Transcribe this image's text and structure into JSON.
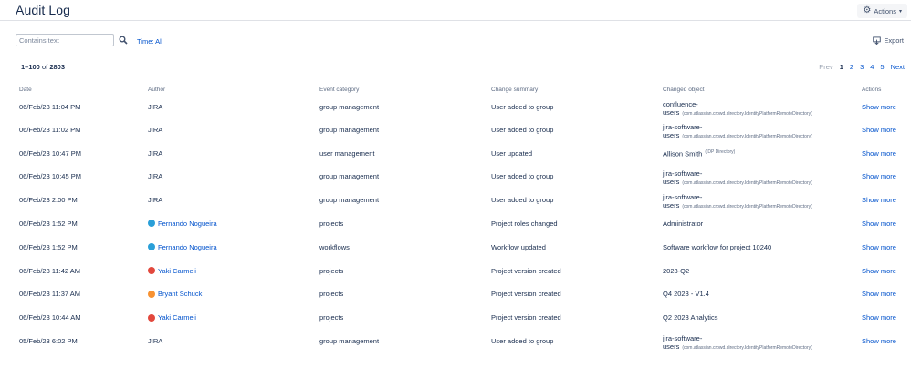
{
  "header": {
    "title": "Audit Log",
    "actions_label": "Actions"
  },
  "toolbar": {
    "search_placeholder": "Contains text",
    "time_filter": "Time: All",
    "export_label": "Export"
  },
  "summary": {
    "range": "1–100",
    "of": "of",
    "total": "2803"
  },
  "pagination": {
    "prev": "Prev",
    "pages": [
      "1",
      "2",
      "3",
      "4",
      "5"
    ],
    "current": "1",
    "next": "Next"
  },
  "columns": [
    "Date",
    "Author",
    "Event category",
    "Change summary",
    "Changed object",
    "Actions"
  ],
  "rows": [
    {
      "date": "06/Feb/23 11:04 PM",
      "author": "JIRA",
      "author_link": false,
      "avatar_color": "",
      "category": "group management",
      "summary": "User added to group",
      "object_line1": "confluence-",
      "object_line2": "users",
      "object_detail": "(com.atlassian.crowd.directory.IdentityPlatformRemoteDirectory)",
      "action": "Show more"
    },
    {
      "date": "06/Feb/23 11:02 PM",
      "author": "JIRA",
      "author_link": false,
      "avatar_color": "",
      "category": "group management",
      "summary": "User added to group",
      "object_line1": "jira-software-",
      "object_line2": "users",
      "object_detail": "(com.atlassian.crowd.directory.IdentityPlatformRemoteDirectory)",
      "action": "Show more"
    },
    {
      "date": "06/Feb/23 10:47 PM",
      "author": "JIRA",
      "author_link": false,
      "avatar_color": "",
      "category": "user management",
      "summary": "User updated",
      "object_line1": "Allison Smith",
      "object_line2": "",
      "object_detail": "(IDP Directory)",
      "action": "Show more"
    },
    {
      "date": "06/Feb/23 10:45 PM",
      "author": "JIRA",
      "author_link": false,
      "avatar_color": "",
      "category": "group management",
      "summary": "User added to group",
      "object_line1": "jira-software-",
      "object_line2": "users",
      "object_detail": "(com.atlassian.crowd.directory.IdentityPlatformRemoteDirectory)",
      "action": "Show more"
    },
    {
      "date": "06/Feb/23 2:00 PM",
      "author": "JIRA",
      "author_link": false,
      "avatar_color": "",
      "category": "group management",
      "summary": "User added to group",
      "object_line1": "jira-software-",
      "object_line2": "users",
      "object_detail": "(com.atlassian.crowd.directory.IdentityPlatformRemoteDirectory)",
      "action": "Show more"
    },
    {
      "date": "06/Feb/23 1:52 PM",
      "author": "Fernando Nogueira",
      "author_link": true,
      "avatar_color": "#2a9fd8",
      "category": "projects",
      "summary": "Project roles changed",
      "object_line1": "Administrator",
      "object_line2": "",
      "object_detail": "",
      "action": "Show more"
    },
    {
      "date": "06/Feb/23 1:52 PM",
      "author": "Fernando Nogueira",
      "author_link": true,
      "avatar_color": "#2a9fd8",
      "category": "workflows",
      "summary": "Workflow updated",
      "object_line1": "Software workflow for project 10240",
      "object_line2": "",
      "object_detail": "",
      "action": "Show more"
    },
    {
      "date": "06/Feb/23 11:42 AM",
      "author": "Yaki Carmeli",
      "author_link": true,
      "avatar_color": "#e2483d",
      "category": "projects",
      "summary": "Project version created",
      "object_line1": "2023-Q2",
      "object_line2": "",
      "object_detail": "",
      "action": "Show more"
    },
    {
      "date": "06/Feb/23 11:37 AM",
      "author": "Bryant Schuck",
      "author_link": true,
      "avatar_color": "#f79232",
      "category": "projects",
      "summary": "Project version created",
      "object_line1": "Q4 2023 - V1.4",
      "object_line2": "",
      "object_detail": "",
      "action": "Show more"
    },
    {
      "date": "06/Feb/23 10:44 AM",
      "author": "Yaki Carmeli",
      "author_link": true,
      "avatar_color": "#e2483d",
      "category": "projects",
      "summary": "Project version created",
      "object_line1": "Q2 2023 Analytics",
      "object_line2": "",
      "object_detail": "",
      "action": "Show more"
    },
    {
      "date": "05/Feb/23 6:02 PM",
      "author": "JIRA",
      "author_link": false,
      "avatar_color": "",
      "category": "group management",
      "summary": "User added to group",
      "object_line1": "jira-software-",
      "object_line2": "users",
      "object_detail": "(com.atlassian.crowd.directory.IdentityPlatformRemoteDirectory)",
      "action": "Show more"
    }
  ],
  "colors": {
    "link": "#0052cc",
    "text": "#172b4d",
    "muted": "#5e6c84",
    "border": "#dfe1e6"
  },
  "icons": {
    "actions": "gear-icon",
    "search": "search-icon",
    "export": "export-icon"
  }
}
